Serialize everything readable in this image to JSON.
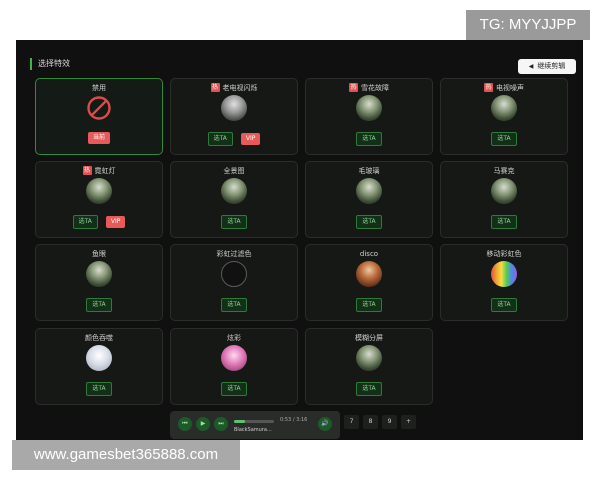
{
  "watermarks": {
    "tg": "TG: MYYJJPP",
    "site": "www.gamesbet365888.com"
  },
  "header": {
    "title": "选择特效",
    "continue_label": "继续剪辑"
  },
  "effects": [
    {
      "name": "禁用",
      "hot": false,
      "thumb": "ban-icon",
      "pick": "",
      "extra": "当前"
    },
    {
      "name": "老电视闪烁",
      "hot": true,
      "thumb": "photo-gray",
      "pick": "选TA",
      "extra": "VIP"
    },
    {
      "name": "雪花故障",
      "hot": true,
      "thumb": "photo",
      "pick": "选TA",
      "extra": ""
    },
    {
      "name": "电视噪声",
      "hot": true,
      "thumb": "photo",
      "pick": "选TA",
      "extra": ""
    },
    {
      "name": "霓虹灯",
      "hot": true,
      "thumb": "photo",
      "pick": "选TA",
      "extra": "VIP"
    },
    {
      "name": "全景图",
      "hot": false,
      "thumb": "photo",
      "pick": "选TA",
      "extra": ""
    },
    {
      "name": "毛玻璃",
      "hot": false,
      "thumb": "photo",
      "pick": "选TA",
      "extra": ""
    },
    {
      "name": "马赛克",
      "hot": false,
      "thumb": "photo",
      "pick": "选TA",
      "extra": ""
    },
    {
      "name": "鱼眼",
      "hot": false,
      "thumb": "photo",
      "pick": "选TA",
      "extra": ""
    },
    {
      "name": "彩虹过滤色",
      "hot": false,
      "thumb": "empty",
      "pick": "选TA",
      "extra": ""
    },
    {
      "name": "disco",
      "hot": false,
      "thumb": "warm",
      "pick": "选TA",
      "extra": ""
    },
    {
      "name": "移动彩虹色",
      "hot": false,
      "thumb": "rainbow",
      "pick": "选TA",
      "extra": ""
    },
    {
      "name": "颜色吞噬",
      "hot": false,
      "thumb": "pale",
      "pick": "选TA",
      "extra": ""
    },
    {
      "name": "炫彩",
      "hot": false,
      "thumb": "pink",
      "pick": "选TA",
      "extra": ""
    },
    {
      "name": "模糊分屏",
      "hot": false,
      "thumb": "photo",
      "pick": "选TA",
      "extra": ""
    }
  ],
  "hot_badge": "热",
  "player": {
    "time": "0:53 / 3:16",
    "track": "BlackSamura...",
    "progress": 0.27
  },
  "pagination": [
    "7",
    "8",
    "9",
    "+"
  ],
  "colors": {
    "accent": "#3fb24f",
    "vip": "#e85a5a",
    "panel": "#0f100f"
  }
}
